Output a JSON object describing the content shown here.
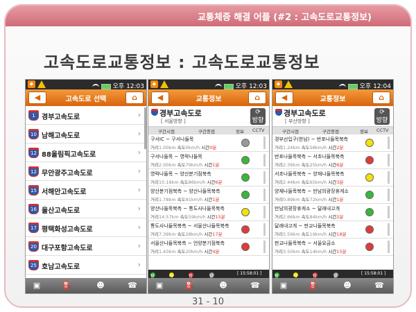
{
  "slide": {
    "header_text": "교통체증 해결 어플 (#2 : 고속도로교통정보)",
    "title": "고속도로교통정보 : 고속도로교통정보",
    "page_number": "31 - 10"
  },
  "colors": {
    "accent": "#d9640c",
    "header_pink": "#cf6c77",
    "green": "#38b838",
    "yellow": "#f2e400",
    "red": "#e23a3a",
    "gray": "#9a9a9a"
  },
  "phones": [
    {
      "status": {
        "ampm": "오후",
        "time": "12:03"
      },
      "title": "고속도로 선택",
      "highways": [
        {
          "number": "1",
          "name": "경부고속도로"
        },
        {
          "number": "10",
          "name": "남해고속도로"
        },
        {
          "number": "12",
          "name": "88올림픽고속도로"
        },
        {
          "number": "12",
          "name": "무안광주고속도로"
        },
        {
          "number": "15",
          "name": "서해안고속도로"
        },
        {
          "number": "16",
          "name": "울산고속도로"
        },
        {
          "number": "17",
          "name": "평택화성고속도로"
        },
        {
          "number": "20",
          "name": "대구포항고속도로"
        },
        {
          "number": "25",
          "name": "호남고속도로"
        }
      ]
    },
    {
      "status": {
        "ampm": "오후",
        "time": "12:03"
      },
      "title": "교통정보",
      "road": "경부고속도로",
      "direction": "[ 서울방향 ]",
      "refresh_label": "방향",
      "columns": [
        "구간시점",
        "구간종점",
        "정보",
        "CCTV"
      ],
      "segments": [
        {
          "from": "구서IC",
          "to": "구서나들목",
          "dist": "1.00",
          "speed": "0",
          "time": "0",
          "status": "gray"
        },
        {
          "from": "구서나들목",
          "to": "영락나들목",
          "dist": "2.00",
          "speed": "79",
          "time": "1",
          "status": "green"
        },
        {
          "from": "영락나들목",
          "to": "양산분기점북측",
          "dist": "10.16",
          "speed": "86",
          "time": "6",
          "status": "green"
        },
        {
          "from": "양산분기점북측",
          "to": "양산나들목북측",
          "dist": "1.78",
          "speed": "91",
          "time": "1",
          "status": "green"
        },
        {
          "from": "양산나들목북측",
          "to": "통도사나들목북측",
          "dist": "14.57",
          "speed": "59",
          "time": "15",
          "status": "yellow"
        },
        {
          "from": "통도사나들목북측",
          "to": "서울산나들목북측",
          "dist": "7.39",
          "speed": "28",
          "time": "17",
          "status": "red"
        },
        {
          "from": "서울산나들목북측",
          "to": "언양분기점북측",
          "dist": "1.43",
          "speed": "20",
          "time": "4",
          "status": "red"
        }
      ],
      "legend": {
        "smooth": "원활",
        "slow": "서행",
        "jam": "정체",
        "none": "없음",
        "updated": "[ 15:58:01 ]"
      }
    },
    {
      "status": {
        "ampm": "오후",
        "time": "12:04"
      },
      "title": "교통정보",
      "road": "경부고속도로",
      "direction": "[ 부산방향 ]",
      "refresh_label": "방향",
      "columns": [
        "구간시점",
        "구간종점",
        "정보",
        "CCTV"
      ],
      "segments": [
        {
          "from": "경부선입구(한남)",
          "to": "반포나들목북측",
          "dist": "1.24",
          "speed": "58",
          "time": "2",
          "status": "yellow"
        },
        {
          "from": "반포나들목북측",
          "to": "서초나들목북측",
          "dist": "2.39",
          "speed": "25",
          "time": "6",
          "status": "red"
        },
        {
          "from": "서초나들목북측",
          "to": "양재나들목북측",
          "dist": "2.44",
          "speed": "65",
          "time": "3",
          "status": "yellow"
        },
        {
          "from": "양재나들목북측",
          "to": "만남의광장휴게소",
          "dist": "0.89",
          "speed": "72",
          "time": "1",
          "status": "green"
        },
        {
          "from": "만남의광장휴게소",
          "to": "달래내고개",
          "dist": "2.66",
          "speed": "84",
          "time": "2",
          "status": "green"
        },
        {
          "from": "달래내고개",
          "to": "판교나들목북측",
          "dist": "5.59",
          "speed": "19",
          "time": "18",
          "status": "red"
        },
        {
          "from": "판교나들목북측",
          "to": "서울요금소",
          "dist": "3.50",
          "speed": "14",
          "time": "15",
          "status": "red"
        }
      ],
      "legend": {
        "smooth": "원활",
        "slow": "서행",
        "jam": "정체",
        "none": "없음",
        "updated": "[ 15:58:01 ]"
      }
    }
  ],
  "labels": {
    "dist": "거리",
    "km": "km",
    "speed": "속도",
    "kmh": "km/h",
    "time": "시간",
    "min": "분"
  },
  "icons": [
    "back-arrow-icon",
    "home-icon",
    "refresh-icon",
    "warning-icon",
    "wifi-icon",
    "battery-icon"
  ]
}
